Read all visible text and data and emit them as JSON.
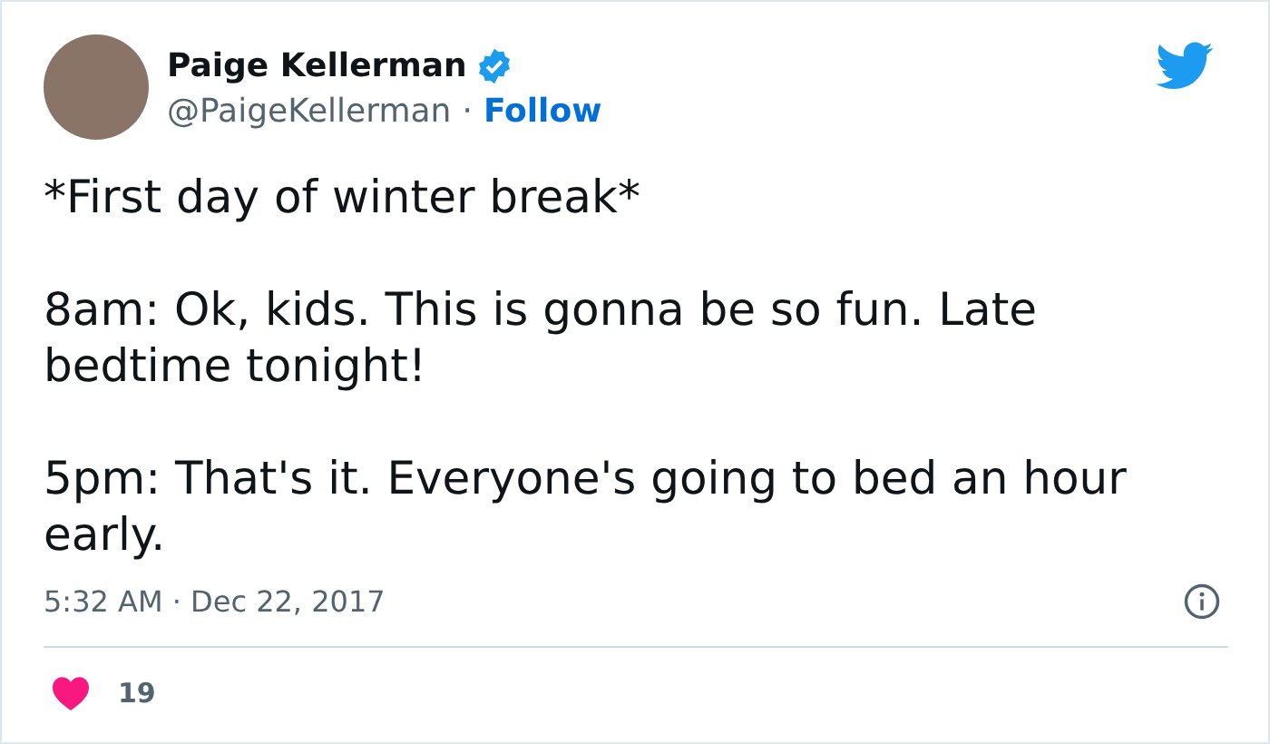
{
  "author": {
    "name": "Paige Kellerman",
    "verified": true,
    "handle": "@PaigeKellerman",
    "separator": "·",
    "follow": "Follow"
  },
  "tweet": {
    "paragraphs": [
      "*First day of winter break*",
      "8am: Ok, kids. This is gonna be so fun. Late bedtime tonight!",
      "5pm: That's it. Everyone's going to bed an hour early."
    ],
    "time": "5:32 AM",
    "separator": "·",
    "date": "Dec 22, 2017"
  },
  "likes": "19"
}
